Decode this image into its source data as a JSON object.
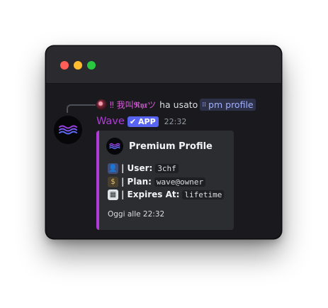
{
  "reply": {
    "username": "‼ 我叫𝕽𝖞𝖝ツ",
    "action": "ha usato",
    "command": "pm profile"
  },
  "message": {
    "bot_name": "Wave",
    "app_tag": "APP",
    "timestamp": "22:32"
  },
  "embed": {
    "title": "Premium Profile",
    "accent_color": "#b13bd8",
    "fields": [
      {
        "icon": "bust-in-silhouette-icon",
        "label": "| User:",
        "value": "3chf"
      },
      {
        "icon": "money-bag-icon",
        "label": "| Plan:",
        "value": "wave@owner"
      },
      {
        "icon": "calendar-icon",
        "label": "| Expires At:",
        "value": "lifetime"
      }
    ],
    "footer": "Oggi alle 22:32"
  },
  "colors": {
    "bot_name": "#b13bd8",
    "app_tag_bg": "#5865f2",
    "command_fg": "#a0b0ff",
    "window_bg": "#1a1a1e"
  }
}
